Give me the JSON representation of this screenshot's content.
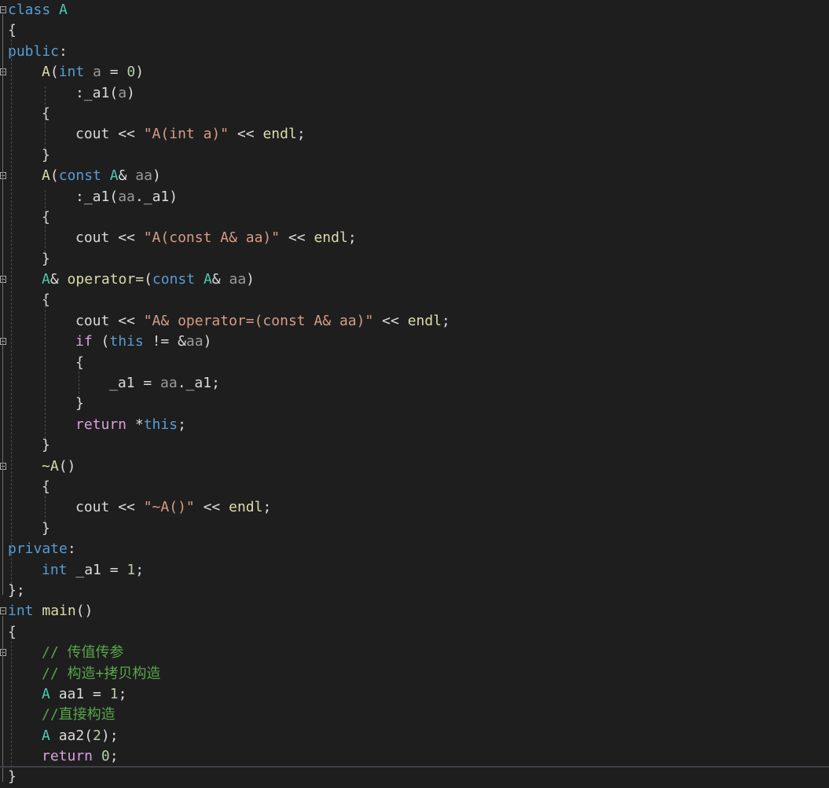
{
  "editor": {
    "language": "C++",
    "colors": {
      "background": "#1e1e1e",
      "keyword": "#569cd6",
      "control_keyword": "#d8a0df",
      "type": "#4ec9b0",
      "function": "#dcdcaa",
      "string": "#d69d85",
      "number": "#b5cea8",
      "comment": "#57a64a",
      "default": "#dcdcdc"
    },
    "lines": [
      {
        "indent": 0,
        "fold": true,
        "tokens": [
          [
            "kw",
            "class"
          ],
          [
            "p",
            " "
          ],
          [
            "ty",
            "A"
          ]
        ]
      },
      {
        "indent": 0,
        "fold": false,
        "tokens": [
          [
            "p",
            "{"
          ]
        ]
      },
      {
        "indent": 0,
        "fold": false,
        "tokens": [
          [
            "kw",
            "public"
          ],
          [
            "p",
            ":"
          ]
        ]
      },
      {
        "indent": 1,
        "fold": true,
        "tokens": [
          [
            "fn",
            "A"
          ],
          [
            "p",
            "("
          ],
          [
            "kw",
            "int"
          ],
          [
            "p",
            " "
          ],
          [
            "pm",
            "a"
          ],
          [
            "p",
            " = "
          ],
          [
            "num",
            "0"
          ],
          [
            "p",
            ")"
          ]
        ]
      },
      {
        "indent": 2,
        "fold": false,
        "tokens": [
          [
            "p",
            ":"
          ],
          [
            "var",
            "_a1"
          ],
          [
            "p",
            "("
          ],
          [
            "pm",
            "a"
          ],
          [
            "p",
            ")"
          ]
        ]
      },
      {
        "indent": 1,
        "fold": false,
        "tokens": [
          [
            "p",
            "{"
          ]
        ]
      },
      {
        "indent": 2,
        "fold": false,
        "tokens": [
          [
            "var",
            "cout"
          ],
          [
            "p",
            " << "
          ],
          [
            "str",
            "\"A(int a)\""
          ],
          [
            "p",
            " << "
          ],
          [
            "fn",
            "endl"
          ],
          [
            "p",
            ";"
          ]
        ]
      },
      {
        "indent": 1,
        "fold": false,
        "tokens": [
          [
            "p",
            "}"
          ]
        ]
      },
      {
        "indent": 1,
        "fold": true,
        "tokens": [
          [
            "fn",
            "A"
          ],
          [
            "p",
            "("
          ],
          [
            "kw",
            "const"
          ],
          [
            "p",
            " "
          ],
          [
            "ty",
            "A"
          ],
          [
            "p",
            "& "
          ],
          [
            "pm",
            "aa"
          ],
          [
            "p",
            ")"
          ]
        ]
      },
      {
        "indent": 2,
        "fold": false,
        "tokens": [
          [
            "p",
            ":"
          ],
          [
            "var",
            "_a1"
          ],
          [
            "p",
            "("
          ],
          [
            "pm",
            "aa"
          ],
          [
            "p",
            "."
          ],
          [
            "var",
            "_a1"
          ],
          [
            "p",
            ")"
          ]
        ]
      },
      {
        "indent": 1,
        "fold": false,
        "tokens": [
          [
            "p",
            "{"
          ]
        ]
      },
      {
        "indent": 2,
        "fold": false,
        "tokens": [
          [
            "var",
            "cout"
          ],
          [
            "p",
            " << "
          ],
          [
            "str",
            "\"A(const A& aa)\""
          ],
          [
            "p",
            " << "
          ],
          [
            "fn",
            "endl"
          ],
          [
            "p",
            ";"
          ]
        ]
      },
      {
        "indent": 1,
        "fold": false,
        "tokens": [
          [
            "p",
            "}"
          ]
        ]
      },
      {
        "indent": 1,
        "fold": true,
        "tokens": [
          [
            "ty",
            "A"
          ],
          [
            "p",
            "& "
          ],
          [
            "fn",
            "operator="
          ],
          [
            "p",
            "("
          ],
          [
            "kw",
            "const"
          ],
          [
            "p",
            " "
          ],
          [
            "ty",
            "A"
          ],
          [
            "p",
            "& "
          ],
          [
            "pm",
            "aa"
          ],
          [
            "p",
            ")"
          ]
        ]
      },
      {
        "indent": 1,
        "fold": false,
        "tokens": [
          [
            "p",
            "{"
          ]
        ]
      },
      {
        "indent": 2,
        "fold": false,
        "tokens": [
          [
            "var",
            "cout"
          ],
          [
            "p",
            " << "
          ],
          [
            "str",
            "\"A& operator=(const A& aa)\""
          ],
          [
            "p",
            " << "
          ],
          [
            "fn",
            "endl"
          ],
          [
            "p",
            ";"
          ]
        ]
      },
      {
        "indent": 2,
        "fold": true,
        "tokens": [
          [
            "kwc",
            "if"
          ],
          [
            "p",
            " ("
          ],
          [
            "kw",
            "this"
          ],
          [
            "p",
            " != &"
          ],
          [
            "pm",
            "aa"
          ],
          [
            "p",
            ")"
          ]
        ]
      },
      {
        "indent": 2,
        "fold": false,
        "tokens": [
          [
            "p",
            "{"
          ]
        ]
      },
      {
        "indent": 3,
        "fold": false,
        "tokens": [
          [
            "var",
            "_a1"
          ],
          [
            "p",
            " = "
          ],
          [
            "pm",
            "aa"
          ],
          [
            "p",
            "."
          ],
          [
            "var",
            "_a1"
          ],
          [
            "p",
            ";"
          ]
        ]
      },
      {
        "indent": 2,
        "fold": false,
        "tokens": [
          [
            "p",
            "}"
          ]
        ]
      },
      {
        "indent": 2,
        "fold": false,
        "tokens": [
          [
            "kwc",
            "return"
          ],
          [
            "p",
            " *"
          ],
          [
            "kw",
            "this"
          ],
          [
            "p",
            ";"
          ]
        ]
      },
      {
        "indent": 1,
        "fold": false,
        "tokens": [
          [
            "p",
            "}"
          ]
        ]
      },
      {
        "indent": 1,
        "fold": true,
        "tokens": [
          [
            "fn",
            "~A"
          ],
          [
            "p",
            "()"
          ]
        ]
      },
      {
        "indent": 1,
        "fold": false,
        "tokens": [
          [
            "p",
            "{"
          ]
        ]
      },
      {
        "indent": 2,
        "fold": false,
        "tokens": [
          [
            "var",
            "cout"
          ],
          [
            "p",
            " << "
          ],
          [
            "str",
            "\"~A()\""
          ],
          [
            "p",
            " << "
          ],
          [
            "fn",
            "endl"
          ],
          [
            "p",
            ";"
          ]
        ]
      },
      {
        "indent": 1,
        "fold": false,
        "tokens": [
          [
            "p",
            "}"
          ]
        ]
      },
      {
        "indent": 0,
        "fold": false,
        "tokens": [
          [
            "kw",
            "private"
          ],
          [
            "p",
            ":"
          ]
        ]
      },
      {
        "indent": 1,
        "fold": false,
        "tokens": [
          [
            "kw",
            "int"
          ],
          [
            "p",
            " "
          ],
          [
            "var",
            "_a1"
          ],
          [
            "p",
            " = "
          ],
          [
            "num",
            "1"
          ],
          [
            "p",
            ";"
          ]
        ]
      },
      {
        "indent": 0,
        "fold": false,
        "tokens": [
          [
            "p",
            "};"
          ]
        ]
      },
      {
        "indent": 0,
        "fold": true,
        "tokens": [
          [
            "kw",
            "int"
          ],
          [
            "p",
            " "
          ],
          [
            "fn",
            "main"
          ],
          [
            "p",
            "()"
          ]
        ]
      },
      {
        "indent": 0,
        "fold": false,
        "tokens": [
          [
            "p",
            "{"
          ]
        ]
      },
      {
        "indent": 1,
        "fold": true,
        "tokens": [
          [
            "cmt",
            "// 传值传参"
          ]
        ]
      },
      {
        "indent": 1,
        "fold": false,
        "tokens": [
          [
            "cmt",
            "// 构造+拷贝构造"
          ]
        ]
      },
      {
        "indent": 1,
        "fold": false,
        "tokens": [
          [
            "ty",
            "A"
          ],
          [
            "p",
            " "
          ],
          [
            "var",
            "aa1"
          ],
          [
            "p",
            " = "
          ],
          [
            "num",
            "1"
          ],
          [
            "p",
            ";"
          ]
        ]
      },
      {
        "indent": 1,
        "fold": false,
        "tokens": [
          [
            "cmt",
            "//直接构造"
          ]
        ]
      },
      {
        "indent": 1,
        "fold": false,
        "tokens": [
          [
            "ty",
            "A"
          ],
          [
            "p",
            " "
          ],
          [
            "var",
            "aa2"
          ],
          [
            "p",
            "("
          ],
          [
            "num",
            "2"
          ],
          [
            "p",
            ");"
          ]
        ]
      },
      {
        "indent": 1,
        "fold": false,
        "tokens": [
          [
            "kwc",
            "return"
          ],
          [
            "p",
            " "
          ],
          [
            "num",
            "0"
          ],
          [
            "p",
            ";"
          ]
        ]
      },
      {
        "indent": 0,
        "fold": false,
        "tokens": [
          [
            "p",
            "}"
          ]
        ]
      }
    ]
  }
}
